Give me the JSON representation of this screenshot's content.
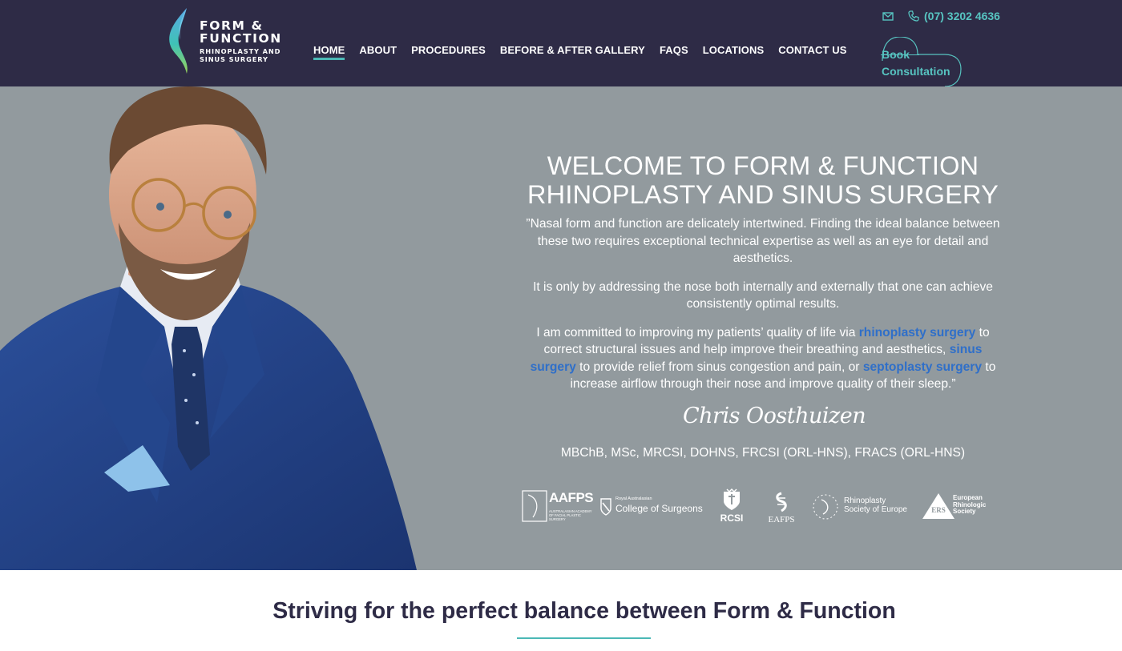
{
  "brand": {
    "name_lines": "FORM &\nFUNCTION",
    "tagline_lines": "RHINOPLASTY AND\nSINUS SURGERY",
    "colors": {
      "navy": "#2e2b46",
      "teal": "#57c4c1",
      "hero_grey": "#929a9e",
      "link_blue": "#2f6fc9"
    }
  },
  "nav": {
    "items": [
      {
        "label": "HOME",
        "active": true
      },
      {
        "label": "ABOUT"
      },
      {
        "label": "PROCEDURES"
      },
      {
        "label": "BEFORE & AFTER GALLERY"
      },
      {
        "label": "FAQS"
      },
      {
        "label": "LOCATIONS"
      },
      {
        "label": "CONTACT US"
      }
    ]
  },
  "contact": {
    "email_icon": "envelope-icon",
    "phone_icon": "phone-icon",
    "phone": "(07) 3202 4636"
  },
  "cta": {
    "book_label": "Book\nConsultation"
  },
  "hero": {
    "title_line1": "WELCOME TO FORM & FUNCTION",
    "title_line2": "RHINOPLASTY AND SINUS SURGERY",
    "para1": "”Nasal form and function are delicately intertwined. Finding the ideal balance between these two requires exceptional technical expertise as well as an eye for detail and aesthetics.",
    "para2": "It is only by addressing the nose both internally and externally that one can achieve consistently optimal results.",
    "para3": {
      "t1": "I am committed to improving my patients’ quality of life via ",
      "link1": "rhinoplasty surgery",
      "t2": " to correct structural issues and help improve their breathing and aesthetics, ",
      "link2": "sinus surgery",
      "t3": " to provide relief from sinus congestion and pain, or ",
      "link3": "septoplasty surgery",
      "t4": " to increase airflow through their nose and improve quality of their sleep.”"
    },
    "signature": "Chris Oosthuizen",
    "credentials": "MBChB, MSc, MRCSI, DOHNS, FRCSI (ORL-HNS), FRACS (ORL-HNS)"
  },
  "associations": {
    "aafps": {
      "name": "AAFPS",
      "sub": "AUSTRALASIAN ACADEMY\nOF FACIAL PLASTIC SURGERY"
    },
    "racs": {
      "small": "Royal Australasian",
      "name": "College of Surgeons"
    },
    "rcsi": {
      "name": "RCSI"
    },
    "eafps": {
      "name": "EAFPS"
    },
    "rse": {
      "name": "Rhinoplasty\nSociety of Europe"
    },
    "ers": {
      "mark": "ERS",
      "name": "European\nRhinologic\nSociety"
    }
  },
  "section": {
    "title": "Striving for the perfect balance between Form & Function"
  }
}
